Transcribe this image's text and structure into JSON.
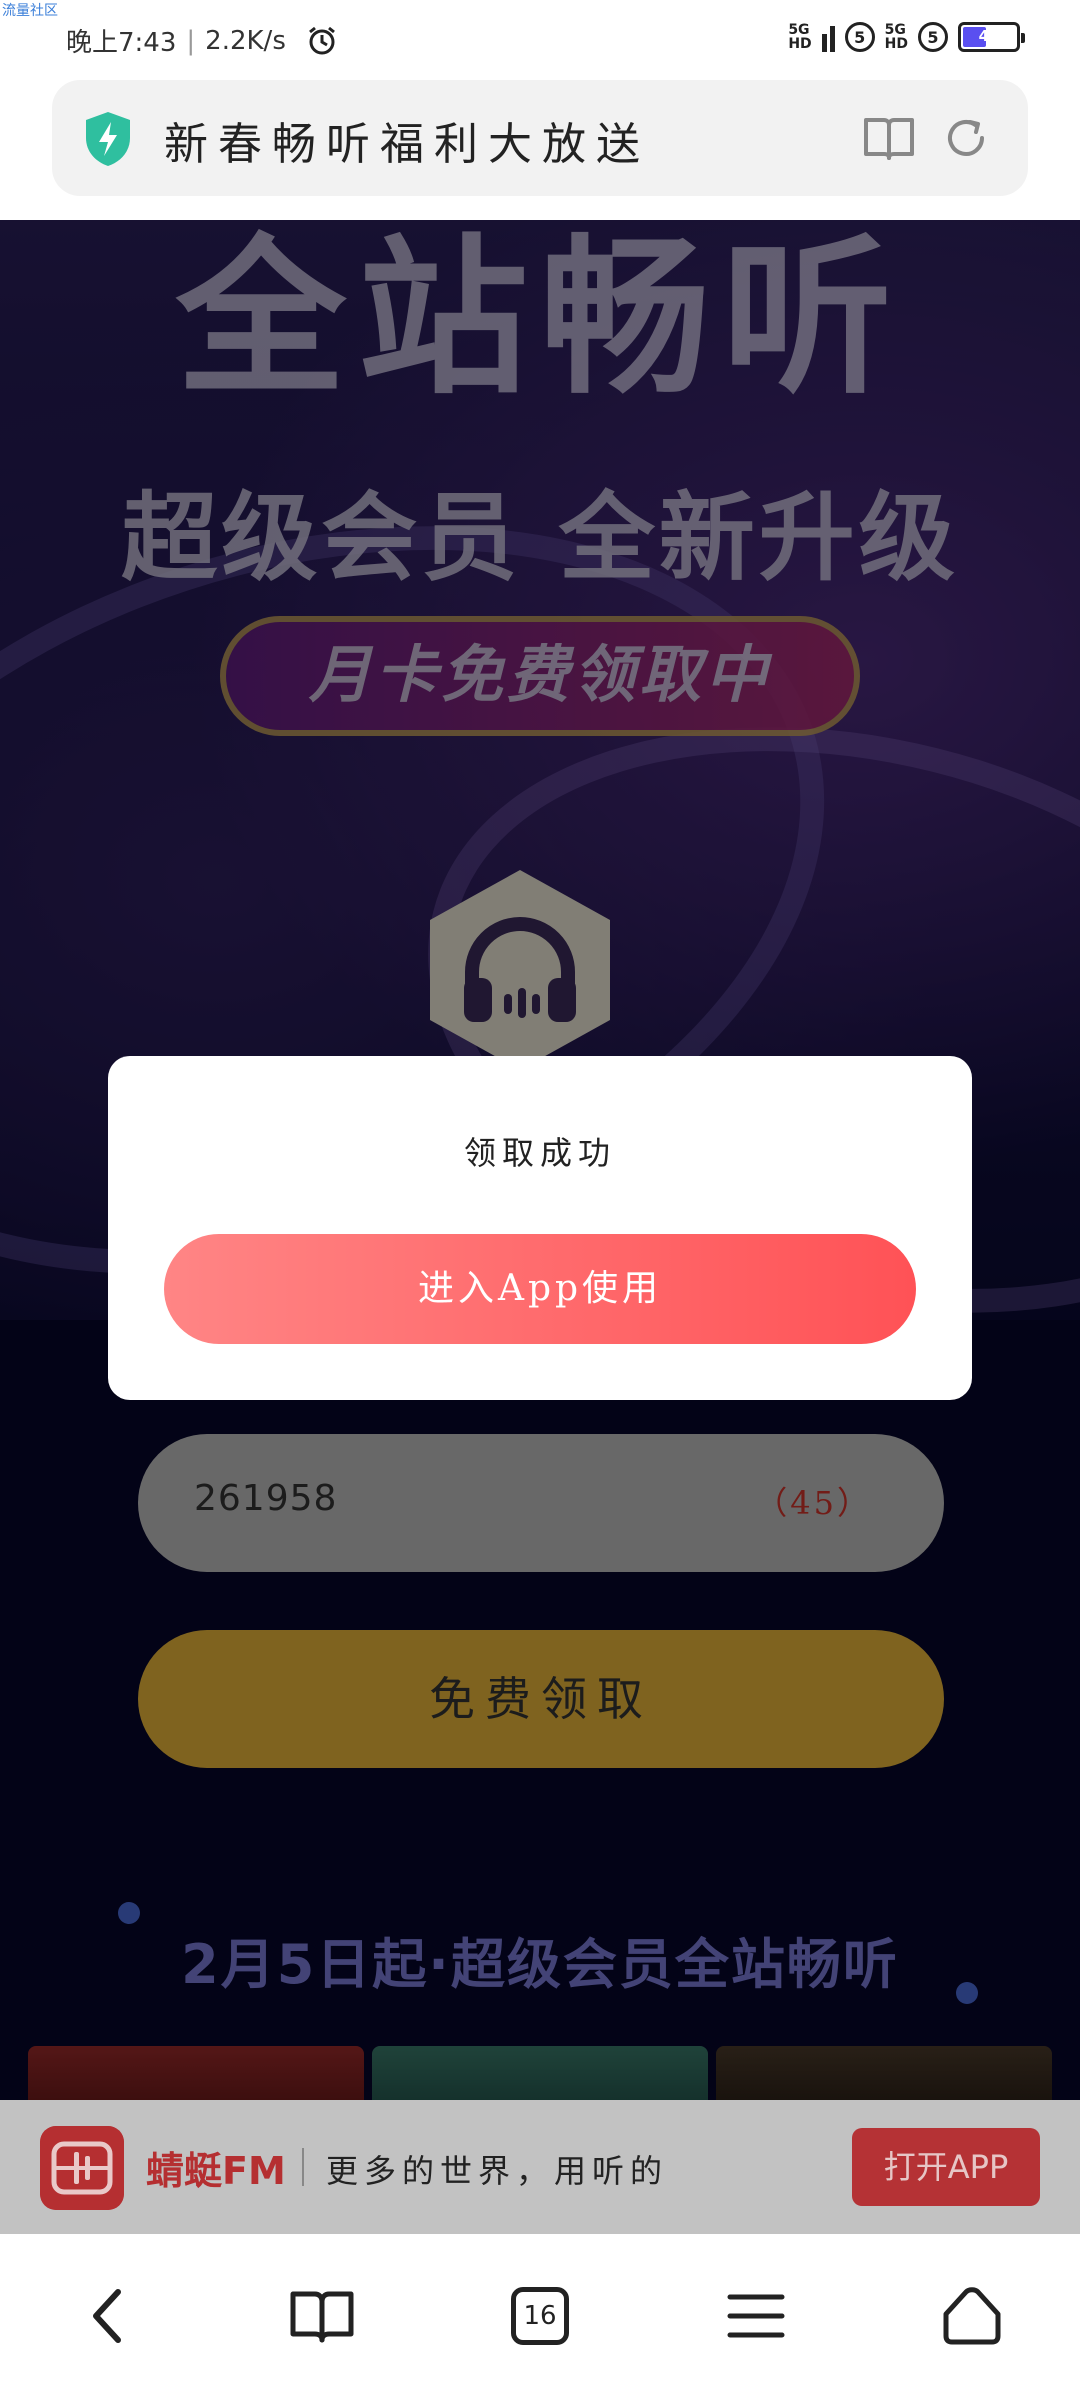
{
  "watermark": "流量社区",
  "status_bar": {
    "time": "晚上7:43",
    "speed": "2.2K/s",
    "network_1": "5G",
    "network_1_sub": "HD",
    "network_2": "5G",
    "network_2_sub": "HD",
    "sim_badge": "5",
    "battery_level": "45",
    "battery_percent": 0.45
  },
  "address_bar": {
    "page_title": "新春畅听福利大放送"
  },
  "hero": {
    "title": "全站畅听",
    "subtitle": "超级会员 全新升级",
    "pill_text": "月卡免费领取中"
  },
  "form": {
    "code_value": "261958",
    "countdown": "（45）",
    "claim_label": "免费领取"
  },
  "section_title": "2月5日起·超级会员全站畅听",
  "modal": {
    "title": "领取成功",
    "button_label": "进入App使用"
  },
  "app_banner": {
    "app_name": "蜻蜓FM",
    "slogan": "更多的世界，用听的",
    "open_label": "打开APP"
  },
  "bottom_nav": {
    "tab_count": "16"
  },
  "colors": {
    "modal_button_start": "#ff8585",
    "modal_button_end": "#ff5256",
    "claim_button": "#e7b53a",
    "brand_red": "#b52f31"
  }
}
